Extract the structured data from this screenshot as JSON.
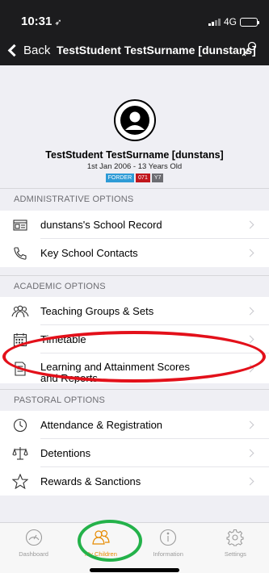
{
  "status": {
    "time": "10:31",
    "network": "4G"
  },
  "nav": {
    "back_label": "Back",
    "title": "TestStudent TestSurname [dunstans]"
  },
  "profile": {
    "name": "TestStudent TestSurname [dunstans]",
    "dob": "1st Jan 2006 - 13 Years Old",
    "badges": [
      {
        "text": "FORDER",
        "color": "#2e9bd6"
      },
      {
        "text": "071",
        "color": "#c0161c"
      },
      {
        "text": "Y7",
        "color": "#6d6d72"
      }
    ]
  },
  "sections": {
    "admin": {
      "header": "ADMINISTRATIVE OPTIONS",
      "items": [
        {
          "label": "dunstans's School Record",
          "icon": "id-card-icon"
        },
        {
          "label": "Key School Contacts",
          "icon": "phone-icon"
        }
      ]
    },
    "academic": {
      "header": "ACADEMIC OPTIONS",
      "items": [
        {
          "label": "Teaching Groups & Sets",
          "icon": "group-icon"
        },
        {
          "label": "Timetable",
          "icon": "calendar-icon"
        },
        {
          "label": "Learning and Attainment Scores and Reports",
          "icon": "document-icon"
        }
      ]
    },
    "pastoral": {
      "header": "PASTORAL OPTIONS",
      "items": [
        {
          "label": "Attendance & Registration",
          "icon": "clock-icon"
        },
        {
          "label": "Detentions",
          "icon": "scales-icon"
        },
        {
          "label": "Rewards & Sanctions",
          "icon": "star-icon"
        }
      ]
    }
  },
  "tabs": [
    {
      "label": "Dashboard",
      "icon": "dashboard-icon",
      "active": false
    },
    {
      "label": "My Children",
      "icon": "people-icon",
      "active": true
    },
    {
      "label": "Information",
      "icon": "info-icon",
      "active": false
    },
    {
      "label": "Settings",
      "icon": "gear-icon",
      "active": false
    }
  ],
  "colors": {
    "accent": "#e68a00",
    "annotation_red": "#e3101a",
    "annotation_green": "#24b24a"
  }
}
